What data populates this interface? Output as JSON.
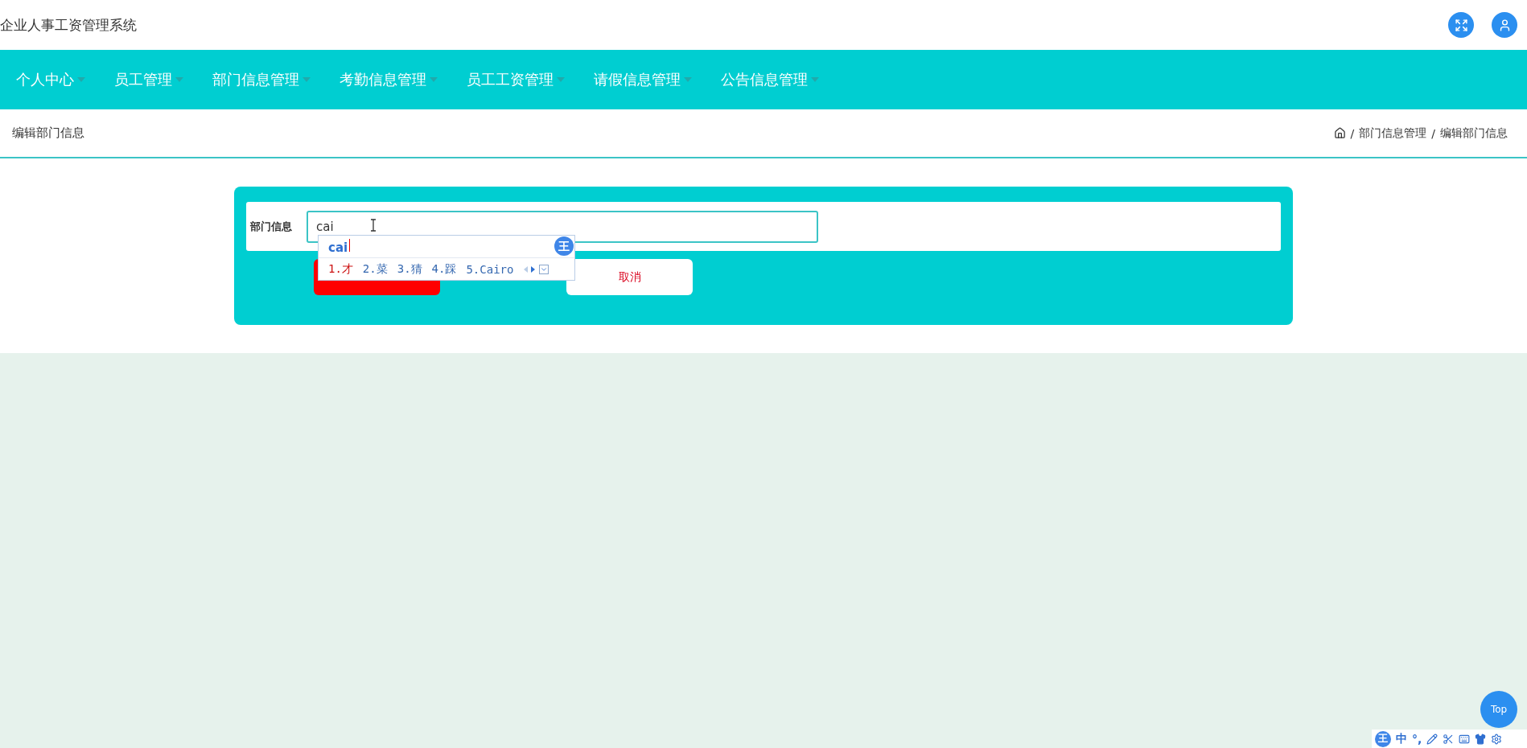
{
  "header": {
    "title": "企业人事工资管理系统"
  },
  "nav": {
    "items": [
      {
        "label": "个人中心"
      },
      {
        "label": "员工管理"
      },
      {
        "label": "部门信息管理"
      },
      {
        "label": "考勤信息管理"
      },
      {
        "label": "员工工资管理"
      },
      {
        "label": "请假信息管理"
      },
      {
        "label": "公告信息管理"
      }
    ]
  },
  "page_header": {
    "title": "编辑部门信息",
    "breadcrumb": [
      {
        "separator": "/",
        "label": "部门信息管理"
      },
      {
        "separator": "/",
        "label": "编辑部门信息"
      }
    ]
  },
  "form": {
    "fields": [
      {
        "label": "部门信息",
        "value": "cai"
      }
    ],
    "buttons": [
      {
        "kind": "submit"
      },
      {
        "kind": "cancel",
        "label": "取消"
      }
    ]
  },
  "ime_popup": {
    "logo": "王",
    "composition": "cai",
    "candidates": [
      {
        "label": "1.才",
        "selected": true
      },
      {
        "label": "2.菜",
        "selected": false
      },
      {
        "label": "3.猜",
        "selected": false
      },
      {
        "label": "4.踩",
        "selected": false
      },
      {
        "label": "5.Cairo",
        "selected": false
      }
    ]
  },
  "back_to_top": {
    "label": "Top"
  },
  "ime_toolbar": {
    "logo": "王",
    "mode": "中",
    "punctuation": "°,"
  }
}
